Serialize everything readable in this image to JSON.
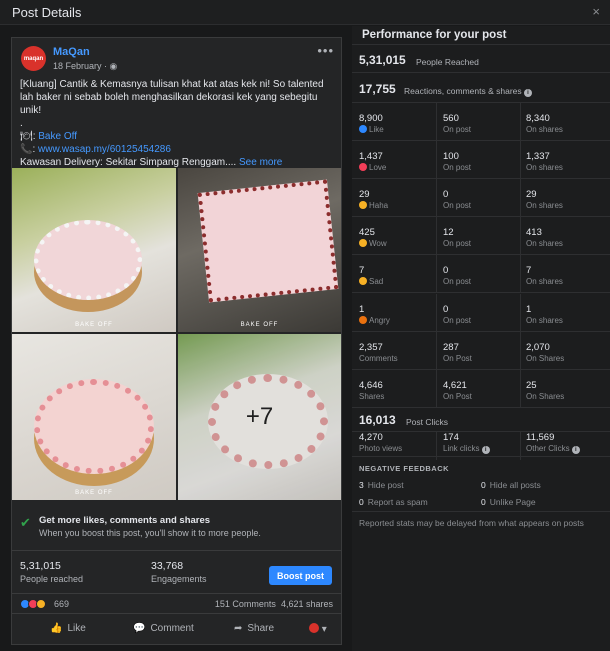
{
  "window": {
    "title": "Post Details",
    "close": "×"
  },
  "post": {
    "page_name": "MaQan",
    "avatar_text": "maqan",
    "date": "18 February · ",
    "menu": "•••",
    "lines": [
      "[Kluang] Cantik & Kemasnya tulisan khat kat atas kek ni! So talented",
      "lah baker ni sebab boleh menghasilkan dekorasi kek yang sebegitu",
      "unik!",
      "."
    ],
    "line_bakeoff_prefix": "🍽: ",
    "line_bakeoff_link": "Bake Off",
    "line_phone_prefix": "📞: ",
    "line_phone_link": "www.wasap.my/60125454286",
    "line_delivery": "Kawasan Delivery: Sekitar Simpang Renggam.... ",
    "see_more": "See more",
    "photo_brand": "BAKE OFF",
    "more_photos": "+7"
  },
  "boost_promo": {
    "title": "Get more likes, comments and shares",
    "subtitle": "When you boost this post, you'll show it to more people."
  },
  "post_stats": {
    "reached_value": "5,31,015",
    "reached_label": "People reached",
    "engagements_value": "33,768",
    "engagements_label": "Engagements",
    "boost_button": "Boost post"
  },
  "reactions_bar": {
    "count": "669",
    "comments": "151 Comments",
    "shares": "4,621 shares",
    "colors": {
      "like": "#2d88ff",
      "love": "#f33e58",
      "wow": "#f7b125"
    }
  },
  "actions": {
    "like": "Like",
    "comment": "Comment",
    "share": "Share"
  },
  "performance": {
    "title": "Performance for your post",
    "people_reached_value": "5,31,015",
    "people_reached_label": "People Reached",
    "reactions_value": "17,755",
    "reactions_label": "Reactions, comments & shares",
    "rows": [
      {
        "name": "like",
        "color": "#2d88ff",
        "total": "8,900",
        "label": "Like",
        "on_post": "560",
        "on_post_label": "On post",
        "on_shares": "8,340",
        "on_shares_label": "On shares"
      },
      {
        "name": "love",
        "color": "#f33e58",
        "total": "1,437",
        "label": "Love",
        "on_post": "100",
        "on_post_label": "On post",
        "on_shares": "1,337",
        "on_shares_label": "On shares"
      },
      {
        "name": "haha",
        "color": "#f7b125",
        "total": "29",
        "label": "Haha",
        "on_post": "0",
        "on_post_label": "On post",
        "on_shares": "29",
        "on_shares_label": "On shares"
      },
      {
        "name": "wow",
        "color": "#f7b125",
        "total": "425",
        "label": "Wow",
        "on_post": "12",
        "on_post_label": "On post",
        "on_shares": "413",
        "on_shares_label": "On shares"
      },
      {
        "name": "sad",
        "color": "#f7b125",
        "total": "7",
        "label": "Sad",
        "on_post": "0",
        "on_post_label": "On post",
        "on_shares": "7",
        "on_shares_label": "On shares"
      },
      {
        "name": "angry",
        "color": "#e9710f",
        "total": "1",
        "label": "Angry",
        "on_post": "0",
        "on_post_label": "On post",
        "on_shares": "1",
        "on_shares_label": "On shares"
      },
      {
        "name": "comments",
        "color": "",
        "total": "2,357",
        "label": "Comments",
        "on_post": "287",
        "on_post_label": "On Post",
        "on_shares": "2,070",
        "on_shares_label": "On Shares"
      },
      {
        "name": "shares",
        "color": "",
        "total": "4,646",
        "label": "Shares",
        "on_post": "4,621",
        "on_post_label": "On Post",
        "on_shares": "25",
        "on_shares_label": "On Shares"
      }
    ],
    "post_clicks_value": "16,013",
    "post_clicks_label": "Post Clicks",
    "photo_views_value": "4,270",
    "photo_views_label": "Photo views",
    "link_clicks_value": "174",
    "link_clicks_label": "Link clicks",
    "other_clicks_value": "11,569",
    "other_clicks_label": "Other Clicks",
    "negative_title": "NEGATIVE FEEDBACK",
    "hide_post_value": "3",
    "hide_post_label": "Hide post",
    "hide_all_value": "0",
    "hide_all_label": "Hide all posts",
    "report_value": "0",
    "report_label": "Report as spam",
    "unlike_value": "0",
    "unlike_label": "Unlike Page",
    "footer_note": "Reported stats may be delayed from what appears on posts"
  }
}
